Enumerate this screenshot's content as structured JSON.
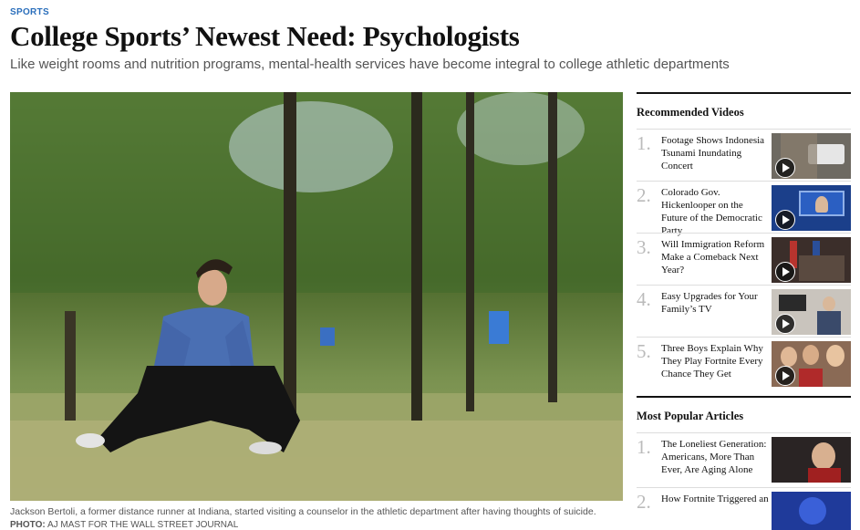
{
  "article": {
    "section": "SPORTS",
    "headline": "College Sports’ Newest Need: Psychologists",
    "dek": "Like weight rooms and nutrition programs, mental-health services have become integral to college athletic departments",
    "caption": "Jackson Bertoli, a former distance runner at Indiana, started visiting a counselor in the athletic department after having thoughts of suicide.",
    "credit_label": "PHOTO:",
    "credit_text": "AJ MAST FOR THE WALL STREET JOURNAL"
  },
  "recommended_videos": {
    "heading": "Recommended Videos",
    "items": [
      {
        "num": "1.",
        "title": "Footage Shows Indonesia Tsunami Inundating Concert",
        "thumb_color": "#6e6a62"
      },
      {
        "num": "2.",
        "title": "Colorado Gov. Hickenlooper on the Future of the Democratic Party",
        "thumb_color": "#1b3f8a"
      },
      {
        "num": "3.",
        "title": "Will Immigration Reform Make a Comeback Next Year?",
        "thumb_color": "#3b2e2a"
      },
      {
        "num": "4.",
        "title": "Easy Upgrades for Your Family’s TV",
        "thumb_color": "#c9c4bd"
      },
      {
        "num": "5.",
        "title": "Three Boys Explain Why They Play Fortnite Every Chance They Get",
        "thumb_color": "#8a6a55"
      }
    ]
  },
  "most_popular": {
    "heading": "Most Popular Articles",
    "items": [
      {
        "num": "1.",
        "title": "The Loneliest Generation: Americans, More Than Ever, Are Aging Alone",
        "thumb_color": "#2a2424"
      },
      {
        "num": "2.",
        "title": "How Fortnite Triggered an",
        "thumb_color": "#1f3a9a"
      }
    ]
  }
}
